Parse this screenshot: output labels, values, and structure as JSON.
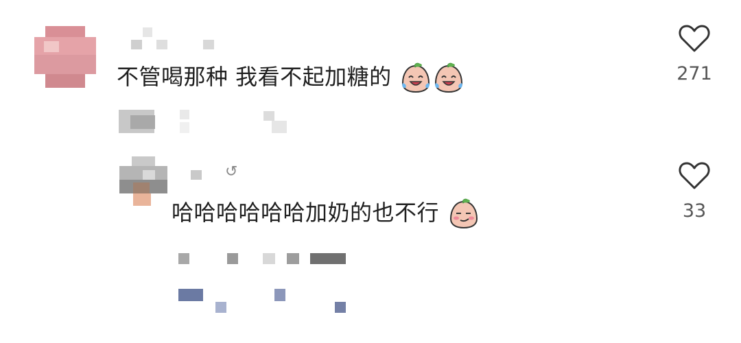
{
  "comments": [
    {
      "text": "不管喝那种 我看不起加糖的",
      "emoji": [
        "crying-laughing-emoji",
        "crying-laughing-emoji"
      ],
      "likes": "271"
    },
    {
      "reply_glyph": "↺",
      "text": "哈哈哈哈哈哈加奶的也不行",
      "emoji": [
        "smirk-emoji"
      ],
      "likes": "33"
    }
  ],
  "colors": {
    "text": "#1f1f1f",
    "meta": "#555555",
    "heart_stroke": "#333333",
    "blur_link": "#5a6a95",
    "avatar_pink": "#e3a0a5"
  }
}
